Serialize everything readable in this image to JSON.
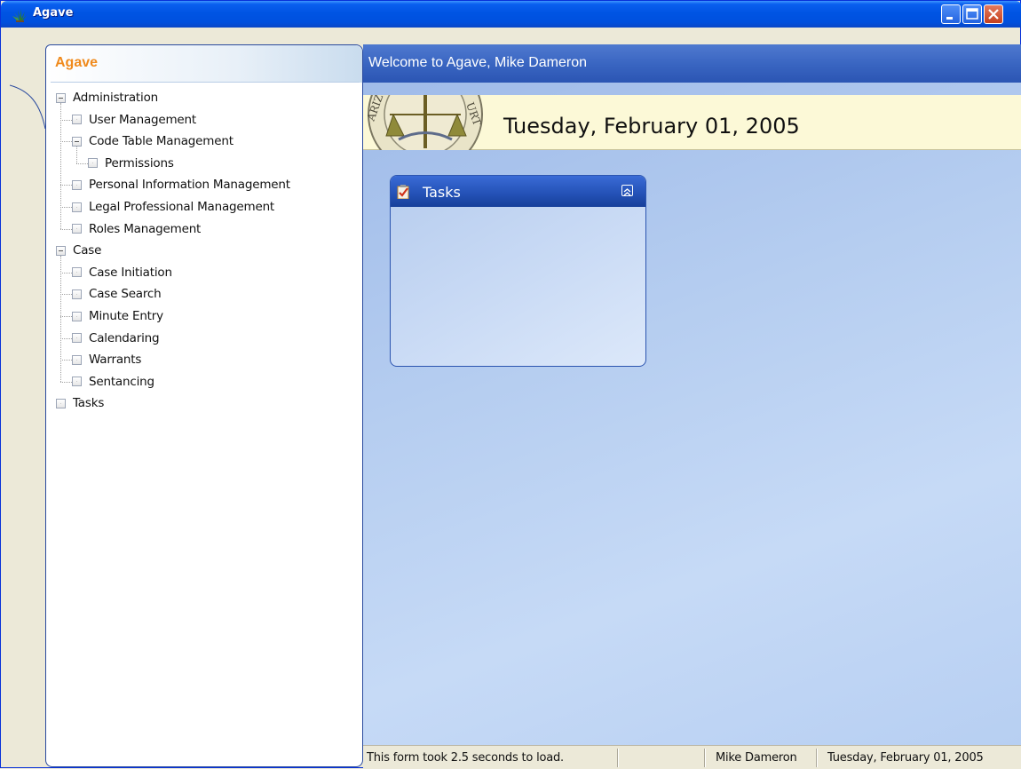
{
  "window": {
    "title": "Agave",
    "icon": "agave-plant-icon"
  },
  "nav": {
    "title": "Agave",
    "tree": [
      {
        "label": "Administration",
        "level": 0,
        "expander": "minus"
      },
      {
        "label": "User Management",
        "level": 1,
        "expander": "leaf"
      },
      {
        "label": "Code Table Management",
        "level": 1,
        "expander": "minus"
      },
      {
        "label": "Permissions",
        "level": 2,
        "expander": "leaf"
      },
      {
        "label": "Personal Information Management",
        "level": 1,
        "expander": "leaf"
      },
      {
        "label": "Legal Professional Management",
        "level": 1,
        "expander": "leaf"
      },
      {
        "label": "Roles Management",
        "level": 1,
        "expander": "leaf"
      },
      {
        "label": "Case",
        "level": 0,
        "expander": "minus"
      },
      {
        "label": "Case Initiation",
        "level": 1,
        "expander": "leaf"
      },
      {
        "label": "Case Search",
        "level": 1,
        "expander": "leaf"
      },
      {
        "label": "Minute Entry",
        "level": 1,
        "expander": "leaf"
      },
      {
        "label": "Calendaring",
        "level": 1,
        "expander": "leaf"
      },
      {
        "label": "Warrants",
        "level": 1,
        "expander": "leaf"
      },
      {
        "label": "Sentancing",
        "level": 1,
        "expander": "leaf"
      },
      {
        "label": "Tasks",
        "level": 0,
        "expander": "leaf"
      }
    ]
  },
  "main": {
    "welcome": "Welcome to Agave, Mike Dameron",
    "date": "Tuesday, February 01, 2005",
    "seal": {
      "text_left": "ARIZ",
      "text_right": "URT"
    },
    "tasks_panel": {
      "title": "Tasks",
      "icon": "clipboard-check-icon",
      "collapse_icon": "chevron-up-double-icon"
    }
  },
  "statusbar": {
    "load_message": "This form took 2.5 seconds to load.",
    "empty_cell": "",
    "user": "Mike Dameron",
    "date": "Tuesday, February 01, 2005"
  },
  "colors": {
    "titlebar": "#0054E3",
    "nav_title": "#F08A1C",
    "header_blue": "#2B55B3",
    "date_bar": "#FCF9D7",
    "content_bg": "#B5CDF0"
  }
}
